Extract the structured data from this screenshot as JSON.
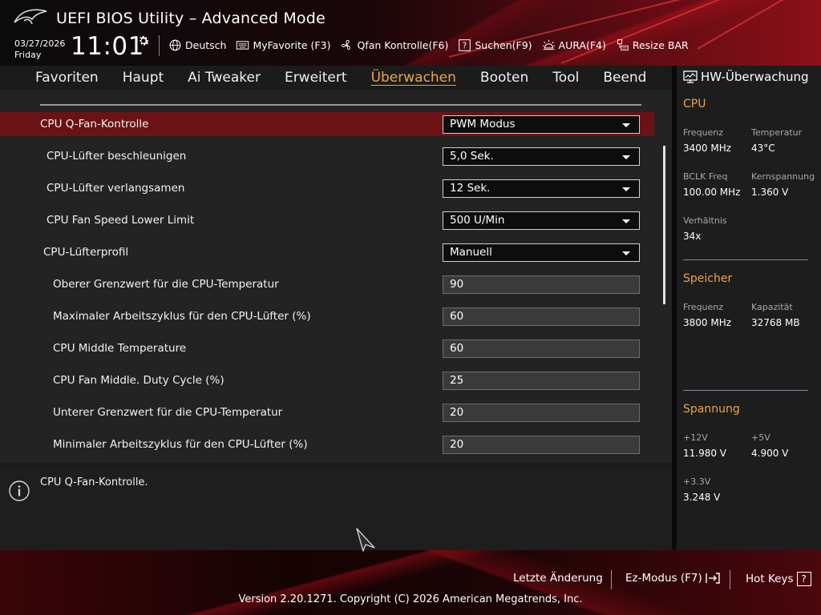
{
  "header": {
    "title": "UEFI BIOS Utility – Advanced Mode",
    "date": "03/27/2026",
    "day": "Friday",
    "time": "11:01",
    "toolbar": [
      {
        "icon": "globe-icon",
        "label": "Deutsch"
      },
      {
        "icon": "keyboard-icon",
        "label": "MyFavorite (F3)"
      },
      {
        "icon": "fan-icon",
        "label": "Qfan Kontrolle(F6)"
      },
      {
        "icon": "help-box-icon",
        "label": "Suchen(F9)"
      },
      {
        "icon": "aura-icon",
        "label": "AURA(F4)"
      },
      {
        "icon": "resize-bar-icon",
        "label": "Resize BAR"
      }
    ]
  },
  "tabs": [
    {
      "label": "Favoriten",
      "active": false
    },
    {
      "label": "Haupt",
      "active": false
    },
    {
      "label": "Ai Tweaker",
      "active": false
    },
    {
      "label": "Erweitert",
      "active": false
    },
    {
      "label": "Überwachen",
      "active": true
    },
    {
      "label": "Booten",
      "active": false
    },
    {
      "label": "Tool",
      "active": false
    },
    {
      "label": "Beend",
      "active": false
    }
  ],
  "settings": [
    {
      "label": "CPU Q-Fan-Kontrolle",
      "value": "PWM Modus",
      "type": "dropdown",
      "selected": true
    },
    {
      "label": "CPU-Lüfter beschleunigen",
      "value": "5,0 Sek.",
      "type": "dropdown",
      "selected": false
    },
    {
      "label": "CPU-Lüfter verlangsamen",
      "value": "12 Sek.",
      "type": "dropdown",
      "selected": false
    },
    {
      "label": "CPU Fan Speed Lower Limit",
      "value": "500 U/Min",
      "type": "dropdown",
      "selected": false
    },
    {
      "label": "CPU-Lüfterprofil",
      "value": "Manuell",
      "type": "dropdown",
      "selected": false
    },
    {
      "label": "Oberer Grenzwert für die CPU-Temperatur",
      "value": "90",
      "type": "field",
      "selected": false
    },
    {
      "label": "Maximaler Arbeitszyklus für den CPU-Lüfter (%)",
      "value": "60",
      "type": "field",
      "selected": false
    },
    {
      "label": "CPU Middle Temperature",
      "value": "60",
      "type": "field",
      "selected": false
    },
    {
      "label": "CPU Fan Middle. Duty Cycle (%)",
      "value": "25",
      "type": "field",
      "selected": false
    },
    {
      "label": "Unterer Grenzwert für die CPU-Temperatur",
      "value": "20",
      "type": "field",
      "selected": false
    },
    {
      "label": "Minimaler Arbeitszyklus für den CPU-Lüfter (%)",
      "value": "20",
      "type": "field",
      "selected": false
    }
  ],
  "help": {
    "icon": "info-icon",
    "text": "CPU Q-Fan-Kontrolle."
  },
  "hw_monitor": {
    "title": "HW-Überwachung",
    "cpu": {
      "section": "CPU",
      "freq_label": "Frequenz",
      "freq_value": "3400 MHz",
      "temp_label": "Temperatur",
      "temp_value": "43°C",
      "bclk_label": "BCLK Freq",
      "bclk_value": "100.00 MHz",
      "vcore_label": "Kernspannung",
      "vcore_value": "1.360 V",
      "ratio_label": "Verhältnis",
      "ratio_value": "34x"
    },
    "memory": {
      "section": "Speicher",
      "freq_label": "Frequenz",
      "freq_value": "3800 MHz",
      "cap_label": "Kapazität",
      "cap_value": "32768 MB"
    },
    "voltage": {
      "section": "Spannung",
      "v12_label": "+12V",
      "v12_value": "11.980 V",
      "v5_label": "+5V",
      "v5_value": "4.900 V",
      "v33_label": "+3.3V",
      "v33_value": "3.248 V"
    }
  },
  "footer": {
    "last_change": "Letzte Änderung",
    "ez_mode": "Ez-Modus (F7)",
    "hot_keys": "Hot Keys",
    "hot_keys_box": "?",
    "copyright": "Version 2.20.1271. Copyright (C) 2026 American Megatrends, Inc."
  },
  "colors": {
    "accent": "#e8a54a",
    "selected_row": "#6b1215",
    "brand_red": "#8c1018"
  }
}
